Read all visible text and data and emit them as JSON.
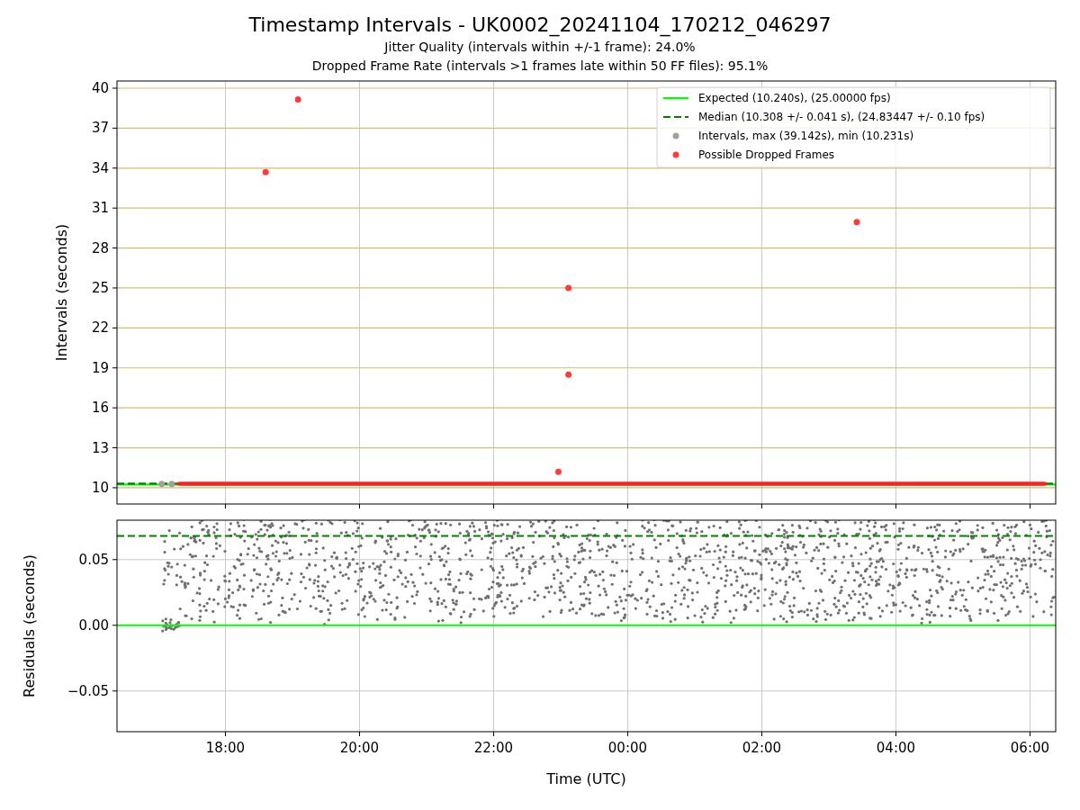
{
  "figure": {
    "title": "Timestamp Intervals - UK0002_20241104_170212_046297",
    "subtitles": [
      "Jitter Quality (intervals within +/-1 frame): 24.0%",
      "Dropped Frame Rate (intervals >1 frames late within 50 FF files): 95.1%"
    ]
  },
  "intervals_plot": {
    "chart_data": {
      "type": "scatter",
      "ylabel": "Intervals (seconds)",
      "grid": true,
      "xlim": [
        "2024-11-04T16:23Z",
        "2024-11-05T06:23Z"
      ],
      "ylim": [
        8.78,
        40.54
      ],
      "yticks": [
        10,
        13,
        16,
        19,
        22,
        25,
        28,
        31,
        34,
        37,
        40
      ],
      "x": [
        "2024-11-04T17:03Z",
        "2024-11-04T17:12Z",
        "2024-11-04T18:36Z",
        "2024-11-04T19:05Z",
        "2024-11-04T22:58Z",
        "2024-11-04T23:07Z",
        "2024-11-04T23:07Z",
        "2024-11-05T03:25Z"
      ],
      "legend": true,
      "bands": [
        {
          "axis": "y",
          "from": 10.15,
          "to": 10.45,
          "color": "#ff2020"
        }
      ],
      "ref_lines": [
        {
          "axis": "y",
          "value": 10.24,
          "color": "#00ff00",
          "label": "Expected (10.240s), (25.00000 fps)"
        },
        {
          "axis": "y",
          "value": 10.308,
          "color": "#008000",
          "label": "Median (10.308 +/- 0.041 s), (24.83447 +/- 0.10 fps)"
        }
      ],
      "series": [
        {
          "name": "Intervals, max (39.142s), min (10.231s)",
          "color": "#a0a0a0",
          "values": [
            10.28,
            10.28,
            null,
            null,
            null,
            null,
            null,
            null
          ]
        },
        {
          "name": "Possible Dropped Frames",
          "color": "#ff3b3b",
          "values": [
            null,
            null,
            33.7,
            39.15,
            11.2,
            25.0,
            18.5,
            29.95
          ]
        }
      ]
    }
  },
  "residuals_plot": {
    "chart_data": {
      "type": "scatter",
      "xlabel": "Time (UTC)",
      "ylabel": "Residuals (seconds)",
      "grid": true,
      "xlim": [
        "2024-11-04T16:23Z",
        "2024-11-05T06:23Z"
      ],
      "ylim": [
        -0.081,
        0.08
      ],
      "xticks": [
        {
          "value": "2024-11-04T18:00Z",
          "label": "18:00"
        },
        {
          "value": "2024-11-04T20:00Z",
          "label": "20:00"
        },
        {
          "value": "2024-11-04T22:00Z",
          "label": "22:00"
        },
        {
          "value": "2024-11-05T00:00Z",
          "label": "00:00"
        },
        {
          "value": "2024-11-05T02:00Z",
          "label": "02:00"
        },
        {
          "value": "2024-11-05T04:00Z",
          "label": "04:00"
        },
        {
          "value": "2024-11-05T06:00Z",
          "label": "06:00"
        }
      ],
      "yticks": [
        {
          "value": -0.05,
          "label": "−0.05"
        },
        {
          "value": 0,
          "label": "0.00"
        },
        {
          "value": 0.05,
          "label": "0.05"
        }
      ],
      "ref_lines": [
        {
          "axis": "y",
          "value": 0,
          "color": "#00ff00"
        },
        {
          "axis": "y",
          "value": 0.068,
          "color": "#008000"
        }
      ]
    }
  }
}
